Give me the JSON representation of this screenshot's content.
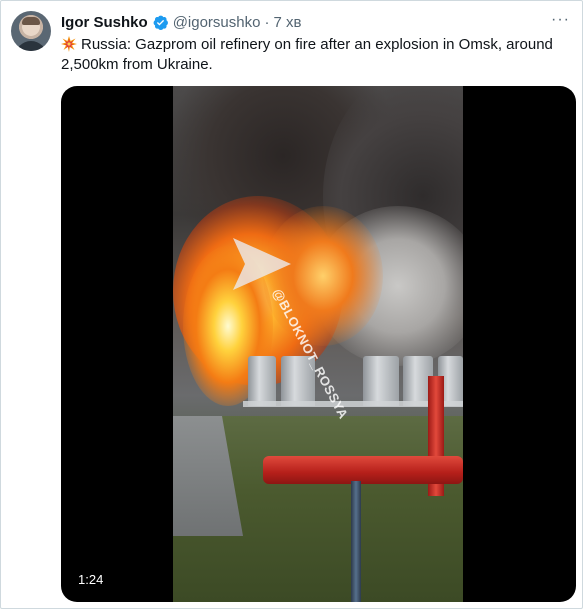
{
  "tweet": {
    "author_name": "Igor Sushko",
    "handle": "@igorsushko",
    "separator": "·",
    "time": "7 хв",
    "text": "Russia: Gazprom oil refinery on fire after an explosion in Omsk, around 2,500km from Ukraine.",
    "emoji": "collision-emoji",
    "verified": true
  },
  "media": {
    "type": "video",
    "duration": "1:24",
    "watermark": "@BLOKNOT_ROSSYA"
  },
  "colors": {
    "verified_badge": "#1d9bf0",
    "secondary_text": "#536471",
    "border": "#cfd9de"
  }
}
